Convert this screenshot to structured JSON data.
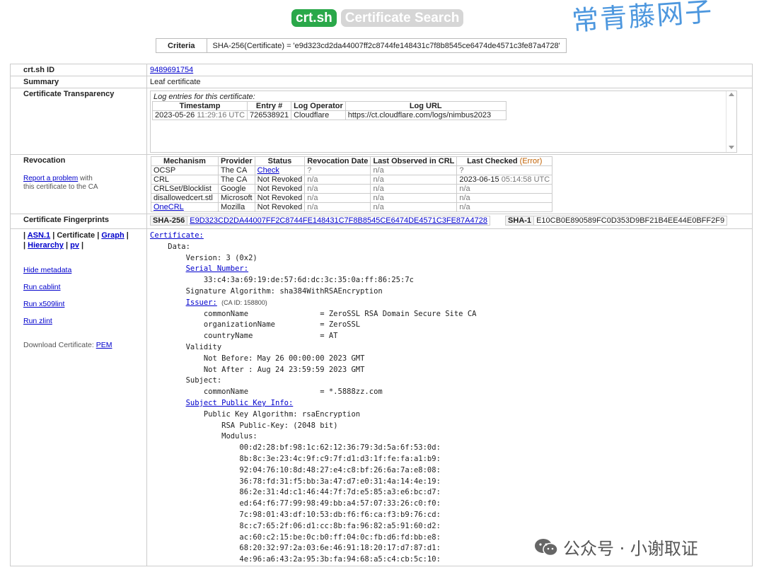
{
  "logo": {
    "left": "crt.sh",
    "right": "Certificate Search"
  },
  "watermark_top": "常青藤网子",
  "watermark_bottom": "公众号 · 小谢取证",
  "criteria": {
    "label": "Criteria",
    "value": "SHA-256(Certificate) = 'e9d323cd2da44007ff2c8744fe148431c7f8b8545ce6474de4571c3fe87a4728'"
  },
  "id": {
    "label": "crt.sh ID",
    "value": "9489691754"
  },
  "summary": {
    "label": "Summary",
    "value": "Leaf certificate"
  },
  "ct": {
    "label": "Certificate Transparency",
    "caption": "Log entries for this certificate:",
    "headers": [
      "Timestamp",
      "Entry #",
      "Log Operator",
      "Log URL"
    ],
    "row": {
      "date": "2023-05-26",
      "time": "11:29:16 UTC",
      "entry": "726538921",
      "operator": "Cloudflare",
      "url": "https://ct.cloudflare.com/logs/nimbus2023"
    }
  },
  "revocation": {
    "label": "Revocation",
    "report_link": "Report a problem",
    "report_rest1": " with",
    "report_rest2": "this certificate to the CA",
    "headers": [
      "Mechanism",
      "Provider",
      "Status",
      "Revocation Date",
      "Last Observed in CRL",
      "Last Checked"
    ],
    "error": "(Error)",
    "rows": [
      {
        "mech": "OCSP",
        "prov": "The CA",
        "status": "Check",
        "rdate": "?",
        "lobs": "n/a",
        "lcheck": "?"
      },
      {
        "mech": "CRL",
        "prov": "The CA",
        "status": "Not Revoked",
        "rdate": "n/a",
        "lobs": "n/a",
        "lcheck": "2023-06-15",
        "lcheck_time": "05:14:58 UTC"
      },
      {
        "mech": "CRLSet/Blocklist",
        "prov": "Google",
        "status": "Not Revoked",
        "rdate": "n/a",
        "lobs": "n/a",
        "lcheck": "n/a"
      },
      {
        "mech": "disallowedcert.stl",
        "prov": "Microsoft",
        "status": "Not Revoked",
        "rdate": "n/a",
        "lobs": "n/a",
        "lcheck": "n/a"
      },
      {
        "mech": "OneCRL",
        "prov": "Mozilla",
        "status": "Not Revoked",
        "rdate": "n/a",
        "lobs": "n/a",
        "lcheck": "n/a"
      }
    ]
  },
  "fingerprints": {
    "label": "Certificate Fingerprints",
    "sha256_label": "SHA-256",
    "sha256": "E9D323CD2DA44007FF2C8744FE148431C7F8B8545CE6474DE4571C3FE87A4728",
    "sha1_label": "SHA-1",
    "sha1": "E10CB0E890589FC0D353D9BF21B4EE44E0BFF2F9"
  },
  "leftnav": {
    "asn1": "ASN.1",
    "certificate": "Certificate",
    "graph": "Graph",
    "hierarchy": "Hierarchy",
    "pv": "pv",
    "hide_metadata": "Hide metadata",
    "cablint": "Run cablint",
    "x509lint": "Run x509lint",
    "zlint": "Run zlint",
    "download": "Download Certificate:",
    "pem": "PEM"
  },
  "cert": {
    "certificate": "Certificate:",
    "data": "Data:",
    "version": "Version: 3 (0x2)",
    "serial_label": "Serial Number:",
    "serial": "33:c4:3a:69:19:de:57:6d:dc:3c:35:0a:ff:86:25:7c",
    "sigalg": "Signature Algorithm: sha384WithRSAEncryption",
    "issuer_label": "Issuer:",
    "issuer_caid": "(CA ID: 158800)",
    "issuer_cn": "commonName                = ZeroSSL RSA Domain Secure Site CA",
    "issuer_o": "organizationName          = ZeroSSL",
    "issuer_c": "countryName               = AT",
    "validity": "Validity",
    "not_before": "Not Before: May 26 00:00:00 2023 GMT",
    "not_after": "Not After : Aug 24 23:59:59 2023 GMT",
    "subject": "Subject:",
    "subject_cn": "commonName                = *.5888zz.com",
    "spki_label": "Subject Public Key Info:",
    "pk_alg": "Public Key Algorithm: rsaEncryption",
    "rsa": "RSA Public-Key: (2048 bit)",
    "modulus": "Modulus:",
    "mod_lines": [
      "00:d2:28:bf:98:1c:62:12:36:79:3d:5a:6f:53:0d:",
      "8b:8c:3e:23:4c:9f:c9:7f:d1:d3:1f:fe:fa:a1:b9:",
      "92:04:76:10:8d:48:27:e4:c8:bf:26:6a:7a:e8:08:",
      "36:78:fd:31:f5:bb:3a:47:d7:e0:31:4a:14:4e:19:",
      "86:2e:31:4d:c1:46:44:7f:7d:e5:85:a3:e6:bc:d7:",
      "ed:64:f6:77:99:98:49:bb:a4:57:07:33:26:c0:f0:",
      "7c:98:01:43:df:10:53:db:f6:f6:ca:f3:b9:76:cd:",
      "8c:c7:65:2f:06:d1:cc:8b:fa:96:82:a5:91:60:d2:",
      "ac:60:c2:15:be:0c:b0:ff:04:0c:fb:d6:fd:bb:e8:",
      "68:20:32:97:2a:03:6e:46:91:18:20:17:d7:87:d1:",
      "4e:96:a6:43:2a:95:3b:fa:94:68:a5:c4:cb:5c:10:"
    ]
  }
}
